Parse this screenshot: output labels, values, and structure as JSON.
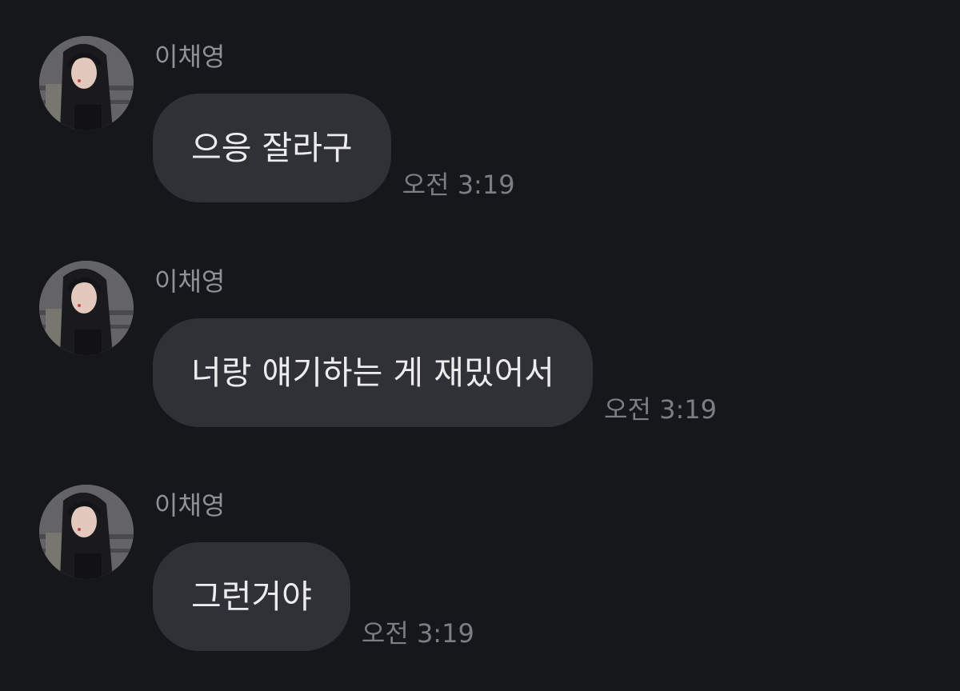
{
  "messages": [
    {
      "sender": "이채영",
      "text": "으응 잘라구",
      "time": "오전 3:19"
    },
    {
      "sender": "이채영",
      "text": "너랑 얘기하는 게 재밌어서",
      "time": "오전 3:19"
    },
    {
      "sender": "이채영",
      "text": "그런거야",
      "time": "오전 3:19"
    }
  ],
  "colors": {
    "background": "#16171b",
    "bubble": "#2f3137",
    "bubble_text": "#ececee",
    "sender_name": "#8f9197",
    "timestamp": "#7c7e84"
  },
  "icons": {
    "avatar": "profile-photo"
  }
}
